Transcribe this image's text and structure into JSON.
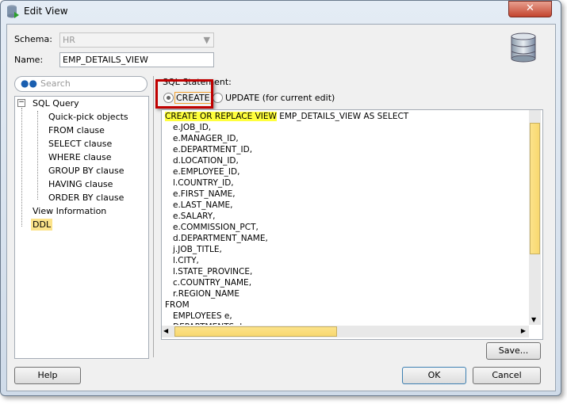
{
  "window": {
    "title": "Edit View",
    "close_label": "✕"
  },
  "form": {
    "schema_label": "Schema:",
    "schema_value": "HR",
    "name_label": "Name:",
    "name_value": "EMP_DETAILS_VIEW"
  },
  "search": {
    "placeholder": "Search"
  },
  "tree": {
    "root": "SQL Query",
    "children": [
      "Quick-pick objects",
      "FROM clause",
      "SELECT clause",
      "WHERE clause",
      "GROUP BY clause",
      "HAVING clause",
      "ORDER BY clause"
    ],
    "items": [
      "View Information",
      "DDL"
    ],
    "selected": "DDL"
  },
  "sql": {
    "label": "SQL Statement:",
    "create_label": "CREATE",
    "update_label": "UPDATE (for current edit)",
    "selected": "CREATE",
    "first_kw": "CREATE OR REPLACE VIEW",
    "first_rest": " EMP_DETAILS_VIEW AS SELECT",
    "lines": [
      "   e.JOB_ID,",
      "   e.MANAGER_ID,",
      "   e.DEPARTMENT_ID,",
      "   d.LOCATION_ID,",
      "   e.EMPLOYEE_ID,",
      "   l.COUNTRY_ID,",
      "   e.FIRST_NAME,",
      "   e.LAST_NAME,",
      "   e.SALARY,",
      "   e.COMMISSION_PCT,",
      "   d.DEPARTMENT_NAME,",
      "   j.JOB_TITLE,",
      "   l.CITY,",
      "   l.STATE_PROVINCE,",
      "   c.COUNTRY_NAME,",
      "   r.REGION_NAME",
      "FROM",
      "   EMPLOYEES e,",
      "   DEPARTMENTS d,"
    ]
  },
  "buttons": {
    "save": "Save...",
    "help": "Help",
    "ok": "OK",
    "cancel": "Cancel"
  },
  "colors": {
    "highlight": "#ffff3c",
    "selection": "#fce38a",
    "callout": "#c00000"
  }
}
